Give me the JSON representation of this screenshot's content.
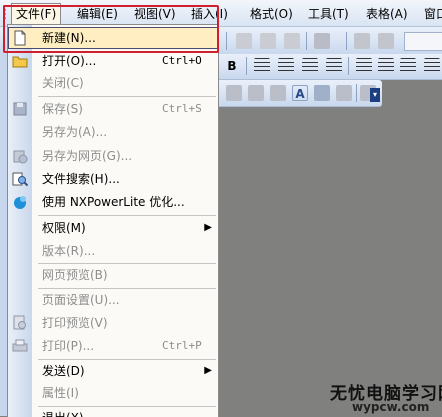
{
  "menubar": {
    "items": [
      {
        "label": "文件(F)"
      },
      {
        "label": "编辑(E)"
      },
      {
        "label": "视图(V)"
      },
      {
        "label": "插入(I)"
      },
      {
        "label": "格式(O)"
      },
      {
        "label": "工具(T)"
      },
      {
        "label": "表格(A)"
      },
      {
        "label": "窗口"
      }
    ]
  },
  "file_menu": {
    "items": [
      {
        "label": "新建(N)...",
        "shortcut": "",
        "enabled": true,
        "highlighted": true,
        "icon": "new-document-icon"
      },
      {
        "label": "打开(O)...",
        "shortcut": "Ctrl+O",
        "enabled": true,
        "icon": "open-folder-icon"
      },
      {
        "label": "关闭(C)",
        "shortcut": "",
        "enabled": false
      },
      {
        "label": "保存(S)",
        "shortcut": "Ctrl+S",
        "enabled": false,
        "icon": "save-icon"
      },
      {
        "label": "另存为(A)...",
        "shortcut": "",
        "enabled": false
      },
      {
        "label": "另存为网页(G)...",
        "shortcut": "",
        "enabled": false,
        "icon": "save-web-icon"
      },
      {
        "label": "文件搜索(H)...",
        "shortcut": "",
        "enabled": true,
        "icon": "file-search-icon"
      },
      {
        "label": "使用 NXPowerLite 优化...",
        "shortcut": "",
        "enabled": true,
        "icon": "nxpowerlite-icon"
      },
      {
        "label": "权限(M)",
        "shortcut": "",
        "enabled": true,
        "submenu": true
      },
      {
        "label": "版本(R)...",
        "shortcut": "",
        "enabled": false
      },
      {
        "label": "网页预览(B)",
        "shortcut": "",
        "enabled": false
      },
      {
        "label": "页面设置(U)...",
        "shortcut": "",
        "enabled": false
      },
      {
        "label": "打印预览(V)",
        "shortcut": "",
        "enabled": false,
        "icon": "print-preview-icon"
      },
      {
        "label": "打印(P)...",
        "shortcut": "Ctrl+P",
        "enabled": false,
        "icon": "print-icon"
      },
      {
        "label": "发送(D)",
        "shortcut": "",
        "enabled": true,
        "submenu": true
      },
      {
        "label": "属性(I)",
        "shortcut": "",
        "enabled": false
      },
      {
        "label": "退出(X)",
        "shortcut": "",
        "enabled": true
      }
    ]
  },
  "watermark": {
    "line1": "无忧电脑学习网",
    "line2": "wypcw.com"
  },
  "colors": {
    "annotation_box": "#d02030",
    "menu_highlight": "#ffeec2",
    "workspace": "#80807e"
  }
}
